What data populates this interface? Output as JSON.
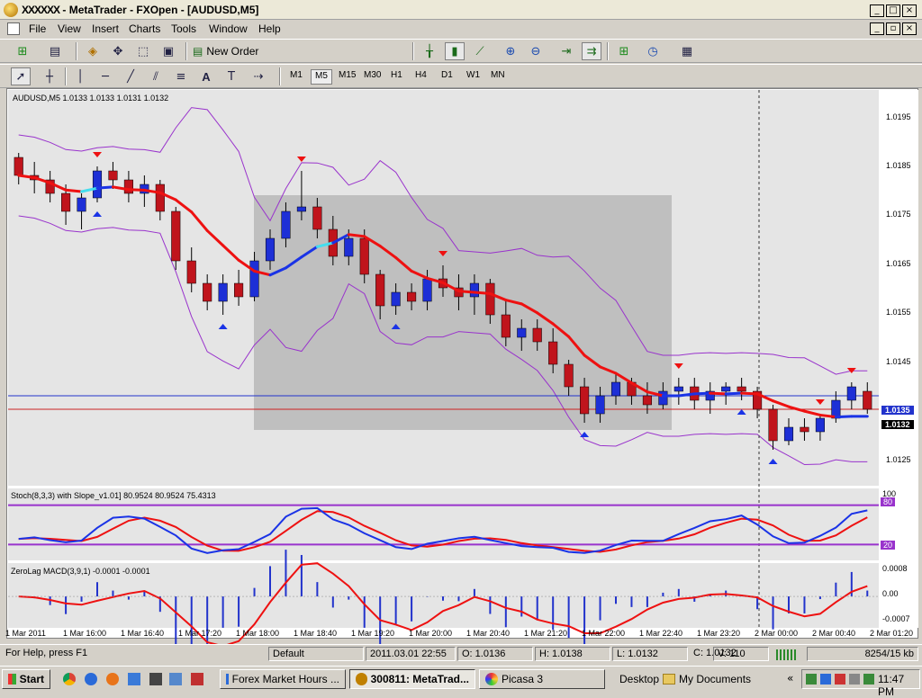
{
  "window": {
    "title": "MetaTrader - FXOpen - [AUDUSD,M5]",
    "title_prefix": "XXXXXX",
    "title_suffix": "MetaTrader - FXOpen - [AUDUSD,M5]",
    "controls": [
      "_",
      "□",
      "×"
    ],
    "mdi_controls": [
      "_",
      "▫",
      "×"
    ]
  },
  "menu": [
    "File",
    "View",
    "Insert",
    "Charts",
    "Tools",
    "Window",
    "Help"
  ],
  "toolbar1": {
    "new_order_label": "New Order"
  },
  "toolbar2": {
    "text_tool": "A",
    "timeframes": [
      "M1",
      "M5",
      "M15",
      "M30",
      "H1",
      "H4",
      "D1",
      "W1",
      "MN"
    ],
    "active_timeframe": "M5"
  },
  "chart": {
    "symbol_header": "AUDUSD,M5  1.0133 1.0133 1.0131 1.0132",
    "price_labels": [
      "1.0195",
      "1.0185",
      "1.0175",
      "1.0165",
      "1.0155",
      "1.0145",
      "1.0135",
      "1.0125"
    ],
    "bid_label": "1.0135",
    "ask_label": "1.0132",
    "time_labels": [
      "1 Mar 2011",
      "1 Mar 16:00",
      "1 Mar 16:40",
      "1 Mar 17:20",
      "1 Mar 18:00",
      "1 Mar 18:40",
      "1 Mar 19:20",
      "1 Mar 20:00",
      "1 Mar 20:40",
      "1 Mar 21:20",
      "1 Mar 22:00",
      "1 Mar 22:40",
      "1 Mar 23:20",
      "2 Mar 00:00",
      "2 Mar 00:40",
      "2 Mar 01:20"
    ],
    "stoch_header": "Stoch(8,3,3) with Slope_v1.01] 80.9524 80.9524 75.4313",
    "stoch_levels": [
      "100",
      "80",
      "20"
    ],
    "macd_header": "ZeroLag MACD(3,9,1) -0.0001 -0.0001",
    "macd_levels": [
      "0.0008",
      "0.00",
      "-0.0007"
    ]
  },
  "status": {
    "help": "For Help, press F1",
    "profile": "Default",
    "datetime": "2011.03.01 22:55",
    "open": "O: 1.0136",
    "high": "H: 1.0138",
    "low": "L: 1.0132",
    "close": "C: 1.0132",
    "volume": "V: 110",
    "traffic": "8254/15 kb"
  },
  "taskbar": {
    "start": "Start",
    "tasks": [
      "Forex Market Hours ...",
      "300811: MetaTrad...",
      "Picasa 3"
    ],
    "desktop": "Desktop",
    "my_documents": "My Documents",
    "clock": "11:47 PM"
  },
  "colors": {
    "bull_candle": "#1d2fd6",
    "bear_candle": "#c0141c",
    "bands": "#9933cc",
    "selection_box": "#b8b8b8",
    "ma_red": "#ee1111",
    "ma_blue": "#1a33e6",
    "ma_cyan": "#44ddee"
  },
  "chart_data": {
    "type": "candlestick",
    "title": "AUDUSD,M5",
    "ylim": [
      1.0115,
      1.0203
    ],
    "series_ohlc_approx": [
      [
        1.0188,
        1.0189,
        1.0182,
        1.0184
      ],
      [
        1.0184,
        1.0187,
        1.018,
        1.0183
      ],
      [
        1.0183,
        1.0185,
        1.0178,
        1.018
      ],
      [
        1.018,
        1.0182,
        1.0173,
        1.0176
      ],
      [
        1.0176,
        1.018,
        1.0172,
        1.0179
      ],
      [
        1.0179,
        1.0186,
        1.0178,
        1.0185
      ],
      [
        1.0185,
        1.0187,
        1.0181,
        1.0183
      ],
      [
        1.0183,
        1.0185,
        1.0178,
        1.018
      ],
      [
        1.018,
        1.0184,
        1.0177,
        1.0182
      ],
      [
        1.0182,
        1.0183,
        1.0174,
        1.0176
      ],
      [
        1.0176,
        1.0177,
        1.0163,
        1.0165
      ],
      [
        1.0165,
        1.0168,
        1.0158,
        1.016
      ],
      [
        1.016,
        1.0162,
        1.0154,
        1.0156
      ],
      [
        1.0156,
        1.0162,
        1.0153,
        1.016
      ],
      [
        1.016,
        1.0163,
        1.0155,
        1.0157
      ],
      [
        1.0157,
        1.0167,
        1.0156,
        1.0165
      ],
      [
        1.0165,
        1.0172,
        1.0163,
        1.017
      ],
      [
        1.017,
        1.0178,
        1.0168,
        1.0176
      ],
      [
        1.0176,
        1.0185,
        1.0174,
        1.0177
      ],
      [
        1.0177,
        1.0179,
        1.017,
        1.0172
      ],
      [
        1.0172,
        1.0175,
        1.0164,
        1.0166
      ],
      [
        1.0166,
        1.0172,
        1.0164,
        1.017
      ],
      [
        1.017,
        1.0172,
        1.016,
        1.0162
      ],
      [
        1.0162,
        1.0163,
        1.0152,
        1.0155
      ],
      [
        1.0155,
        1.016,
        1.0153,
        1.0158
      ],
      [
        1.0158,
        1.016,
        1.0154,
        1.0156
      ],
      [
        1.0156,
        1.0163,
        1.0154,
        1.0161
      ],
      [
        1.0161,
        1.0164,
        1.0157,
        1.0159
      ],
      [
        1.0159,
        1.0162,
        1.0154,
        1.0157
      ],
      [
        1.0157,
        1.0162,
        1.0153,
        1.016
      ],
      [
        1.016,
        1.0161,
        1.0151,
        1.0153
      ],
      [
        1.0153,
        1.0156,
        1.0146,
        1.0148
      ],
      [
        1.0148,
        1.0152,
        1.0145,
        1.015
      ],
      [
        1.015,
        1.0152,
        1.0145,
        1.0147
      ],
      [
        1.0147,
        1.015,
        1.014,
        1.0142
      ],
      [
        1.0142,
        1.0143,
        1.0135,
        1.0137
      ],
      [
        1.0137,
        1.0139,
        1.0129,
        1.0131
      ],
      [
        1.0131,
        1.0137,
        1.0129,
        1.0135
      ],
      [
        1.0135,
        1.014,
        1.0133,
        1.0138
      ],
      [
        1.0138,
        1.0139,
        1.0133,
        1.0135
      ],
      [
        1.0135,
        1.0138,
        1.0131,
        1.0133
      ],
      [
        1.0133,
        1.0138,
        1.0132,
        1.0136
      ],
      [
        1.0136,
        1.0139,
        1.0133,
        1.0137
      ],
      [
        1.0137,
        1.0139,
        1.0132,
        1.0134
      ],
      [
        1.0134,
        1.0138,
        1.0131,
        1.0136
      ],
      [
        1.0136,
        1.0138,
        1.0133,
        1.0137
      ],
      [
        1.0137,
        1.0139,
        1.0134,
        1.0136
      ],
      [
        1.0136,
        1.0137,
        1.013,
        1.0132
      ],
      [
        1.0132,
        1.0133,
        1.0123,
        1.0125
      ],
      [
        1.0125,
        1.013,
        1.0124,
        1.0128
      ],
      [
        1.0128,
        1.013,
        1.0125,
        1.0127
      ],
      [
        1.0127,
        1.0131,
        1.0125,
        1.013
      ],
      [
        1.013,
        1.0136,
        1.0129,
        1.0134
      ],
      [
        1.0134,
        1.0138,
        1.0132,
        1.0137
      ],
      [
        1.0136,
        1.0138,
        1.0131,
        1.0132
      ]
    ],
    "overlays": [
      "Bollinger Bands",
      "Moving Average (red/blue/cyan)"
    ],
    "indicators": [
      {
        "name": "Stoch(8,3,3) with Slope_v1.01]",
        "levels": [
          80,
          20
        ],
        "range": [
          0,
          100
        ]
      },
      {
        "name": "ZeroLag MACD(3,9,1)",
        "range": [
          -0.0007,
          0.0008
        ]
      }
    ]
  }
}
